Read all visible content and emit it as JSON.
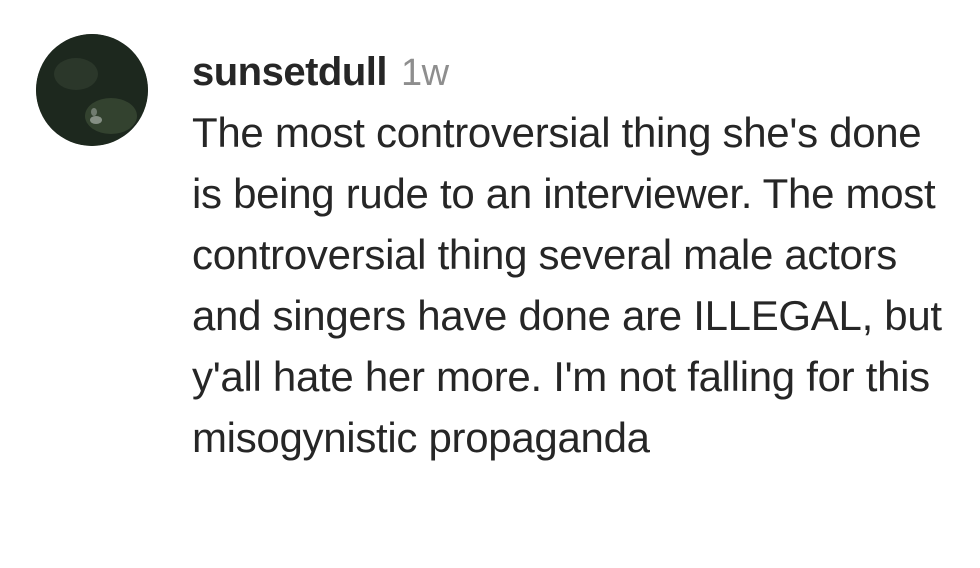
{
  "comment": {
    "username": "sunsetdull",
    "timestamp": "1w",
    "text": "The most controversial thing she's done is being rude to an interviewer. The most controversial thing several male actors and singers have done are ILLEGAL, but y'all hate her more. I'm not falling for this misogynistic propaganda"
  },
  "avatar": {
    "icon": "profile-photo",
    "colors": {
      "background": "#1f2a20"
    }
  }
}
